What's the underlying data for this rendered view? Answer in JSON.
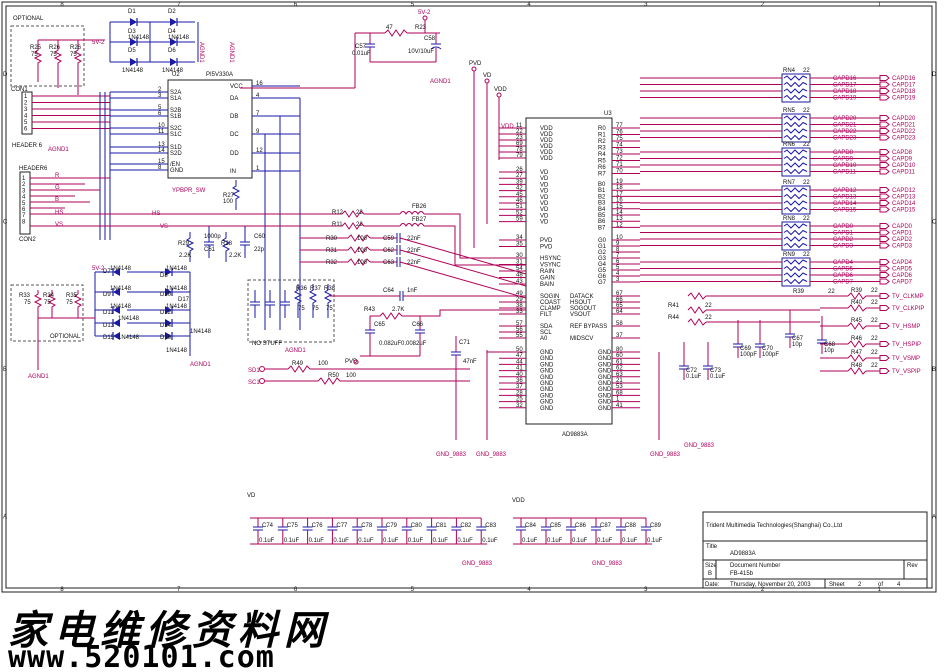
{
  "title_block": {
    "company": "Trident Multimedia Technologies(Shanghai) Co.,Ltd",
    "title_label": "Title",
    "title": "AD9883A",
    "size_label": "Size",
    "size": "B",
    "docnum_label": "Document Number",
    "docnum": "FB-415b",
    "rev_label": "Rev",
    "date_label": "Date:",
    "date": "Thursday, November 20, 2003",
    "sheet_label": "Sheet",
    "sheet": "2",
    "of_label": "of",
    "sheet_total": "4"
  },
  "chips": {
    "u2": {
      "ref": "U2",
      "part": "PI5V330A",
      "left_pins": [
        "S2A",
        "S1A",
        "S2B",
        "S1B",
        "S2C",
        "S1C",
        "S1D",
        "S2D",
        "/EN",
        "GND"
      ],
      "right_pins": [
        "VCC",
        "DA",
        "DB",
        "DC",
        "DD",
        "IN"
      ]
    },
    "u3": {
      "ref": "U3",
      "part": "AD9883A",
      "left_pins": [
        "VDD",
        "VDD",
        "VDD",
        "VDD",
        "VDD",
        "VDD",
        "VD",
        "VD",
        "VD",
        "VD",
        "VD",
        "VD",
        "VD",
        "VD",
        "VD",
        "PVD",
        "PVD",
        "HSYNC",
        "VSYNC",
        "RAIN",
        "GAIN",
        "BAIN",
        "SOGIN",
        "COAST",
        "CLAMP",
        "FILT",
        "SDA",
        "SCL",
        "A0",
        "GND",
        "GND",
        "GND",
        "GND",
        "GND",
        "GND",
        "GND",
        "GND",
        "GND",
        "GND"
      ],
      "right_pins": [
        "R0",
        "R1",
        "R2",
        "R3",
        "R4",
        "R5",
        "R6",
        "R7",
        "B0",
        "B1",
        "B2",
        "B3",
        "B4",
        "B5",
        "B6",
        "B7",
        "G0",
        "G1",
        "G2",
        "G3",
        "G4",
        "G5",
        "G6",
        "G7",
        "DATACK",
        "HSOUT",
        "SOGOUT",
        "VSOUT",
        "REF BYPASS",
        "MIDSCV",
        "GND",
        "GND",
        "GND",
        "GND",
        "GND",
        "GND",
        "GND",
        "GND",
        "GND",
        "GND"
      ]
    }
  },
  "connectors": {
    "con1": {
      "ref": "CON1",
      "name": "HEADER 6"
    },
    "con2": {
      "ref": "CON2",
      "name": "HEADER6"
    }
  },
  "left_labels": [
    "OPTIONAL",
    "R25",
    "R26",
    "R26",
    "75",
    "75",
    "75",
    "5V-2",
    "D1",
    "D2",
    "D3",
    "D4",
    "D5",
    "D6",
    "1N4148",
    "1N4148",
    "1N4148",
    "1N4148",
    "AGND1",
    "AGND1",
    "R",
    "G",
    "B",
    "HS",
    "VS",
    "YPBPR_SW",
    "R27",
    "100",
    "R29",
    "2.2K",
    "R28",
    "2.2K",
    "C61",
    "1000p",
    "C60",
    "22p",
    "5V-2",
    "D7",
    "D8",
    "D9",
    "D10",
    "D11",
    "D12",
    "D13",
    "D14",
    "D15",
    "D16",
    "D17",
    "1N4148",
    "R33",
    "R34",
    "R35",
    "75",
    "75",
    "75",
    "OPTIONAL",
    "AGND1",
    "NO STUFF",
    "R36",
    "R37",
    "R38",
    "75",
    "75",
    "75",
    "SD1",
    "SC1",
    "R49",
    "R50",
    "100",
    "100",
    "PVD"
  ],
  "mid_labels": [
    "5V-2",
    "47",
    "R23",
    "C57",
    "0.01uF",
    "C58",
    "10V/10uF",
    "AGND1",
    "PVD",
    "VD",
    "VDD",
    "R12",
    "R11",
    "FB26",
    "FB27",
    "22",
    "22",
    "R30",
    "R31",
    "R32",
    "100",
    "100",
    "100",
    "C59",
    "C62",
    "C63",
    "22nF",
    "22nF",
    "22nF",
    "C64",
    "1nF",
    "R43",
    "2.7K",
    "C65",
    "C66",
    "0.082uF",
    "0.0082uF",
    "C71",
    "47nF",
    "GND_9883",
    "GND_9883"
  ],
  "right_nets": {
    "rn_blocks": [
      "RN4",
      "RN5",
      "RN6",
      "RN7",
      "RN8",
      "RN9"
    ],
    "rn_value": "22",
    "nets": [
      "CAPD16",
      "CAPD17",
      "CAPD18",
      "CAPD19",
      "CAPD20",
      "CAPD21",
      "CAPD22",
      "CAPD23",
      "CAPD8",
      "CAPD9",
      "CAPD10",
      "CAPD11",
      "CAPD12",
      "CAPD13",
      "CAPD14",
      "CAPD15",
      "CAPD0",
      "CAPD1",
      "CAPD2",
      "CAPD3",
      "CAPD4",
      "CAPD5",
      "CAPD6",
      "CAPD7"
    ],
    "sync_nets": [
      "TV_CLKMP",
      "TV_CLKPIP",
      "TV_HSMP",
      "TV_HSPIP",
      "TV_VSMP",
      "TV_VSPIP"
    ],
    "res": [
      "R39",
      "R40",
      "R41",
      "R42",
      "R44",
      "R45",
      "R46",
      "R47",
      "R48"
    ],
    "res_val": "22",
    "caps": [
      "C72",
      "0.1uF",
      "C73",
      "0.1uF",
      "C69",
      "100pF",
      "C70",
      "100pF",
      "C67",
      "10p",
      "C68",
      "10p"
    ],
    "gnd": "GND_9883"
  },
  "decoupling": {
    "vd_rail": "VD",
    "vdd_rail": "VDD",
    "vd_caps": [
      "C74",
      "C75",
      "C76",
      "C77",
      "C78",
      "C79",
      "C80",
      "C81",
      "C82",
      "C83"
    ],
    "vdd_caps": [
      "C84",
      "C85",
      "C86",
      "C87",
      "C88",
      "C89"
    ],
    "cap_value": "0.1uF",
    "gnd": "GND_9883"
  },
  "watermark": {
    "cn": "家电维修资料网",
    "url": "www.520101.com"
  },
  "border": {
    "cols": [
      "8",
      "7",
      "6",
      "5",
      "4",
      "3",
      "2",
      "1"
    ],
    "rows": [
      "D",
      "C",
      "B",
      "A"
    ]
  }
}
